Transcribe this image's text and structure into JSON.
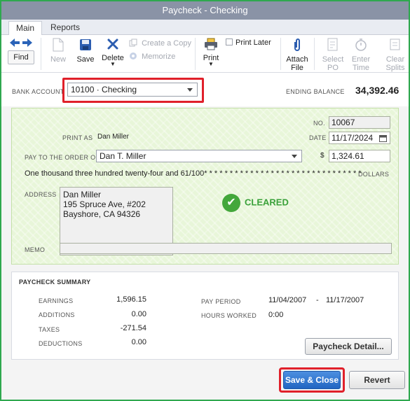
{
  "window": {
    "title": "Paycheck - Checking"
  },
  "tabs": [
    {
      "label": "Main"
    },
    {
      "label": "Reports"
    }
  ],
  "toolbar": {
    "find_label": "Find",
    "new_label": "New",
    "save_label": "Save",
    "delete_label": "Delete",
    "create_copy_label": "Create a Copy",
    "memorize_label": "Memorize",
    "print_label": "Print",
    "print_later_label": "Print Later",
    "attach_file_label": "Attach File",
    "select_po_label": "Select PO",
    "enter_time_label": "Enter Time",
    "clear_splits_label": "Clear Splits"
  },
  "bank": {
    "label": "BANK  ACCOUNT",
    "account": "10100 · Checking",
    "ending_balance_label": "ENDING BALANCE",
    "ending_balance": "34,392.46"
  },
  "check": {
    "no_label": "NO.",
    "no": "10067",
    "print_as_label": "PRINT AS",
    "print_as": "Dan Miller",
    "date_label": "DATE",
    "date": "11/17/2024",
    "pay_to_label": "PAY TO THE ORDER OF",
    "payee": "Dan T. Miller",
    "dollar_sign": "$",
    "amount": "1,324.61",
    "amount_words": "One thousand three hundred twenty-four and 61/100* * * * * * * * * * * * * * * * * * * * * * * * * * * * * * *",
    "dollars_label": "DOLLARS",
    "address_label": "ADDRESS",
    "address_lines": [
      "Dan Miller",
      "195 Spruce Ave, #202",
      "Bayshore, CA 94326"
    ],
    "status": "CLEARED",
    "memo_label": "MEMO",
    "memo": ""
  },
  "summary": {
    "title": "PAYCHECK SUMMARY",
    "earnings_label": "EARNINGS",
    "earnings": "1,596.15",
    "additions_label": "ADDITIONS",
    "additions": "0.00",
    "taxes_label": "TAXES",
    "taxes": "-271.54",
    "deductions_label": "DEDUCTIONS",
    "deductions": "0.00",
    "pay_period_label": "PAY PERIOD",
    "pay_period_start": "11/04/2007",
    "pay_period_dash": "-",
    "pay_period_end": "11/17/2007",
    "hours_worked_label": "HOURS WORKED",
    "hours_worked": "0:00",
    "detail_button": "Paycheck Detail..."
  },
  "footer": {
    "save_close_label": "Save & Close",
    "revert_label": "Revert"
  },
  "colors": {
    "highlight": "#e0202a",
    "window_border": "#2fa84f",
    "check_bg": "#e8f6d9",
    "cleared": "#3aa13a",
    "primary_button": "#2166c2"
  }
}
